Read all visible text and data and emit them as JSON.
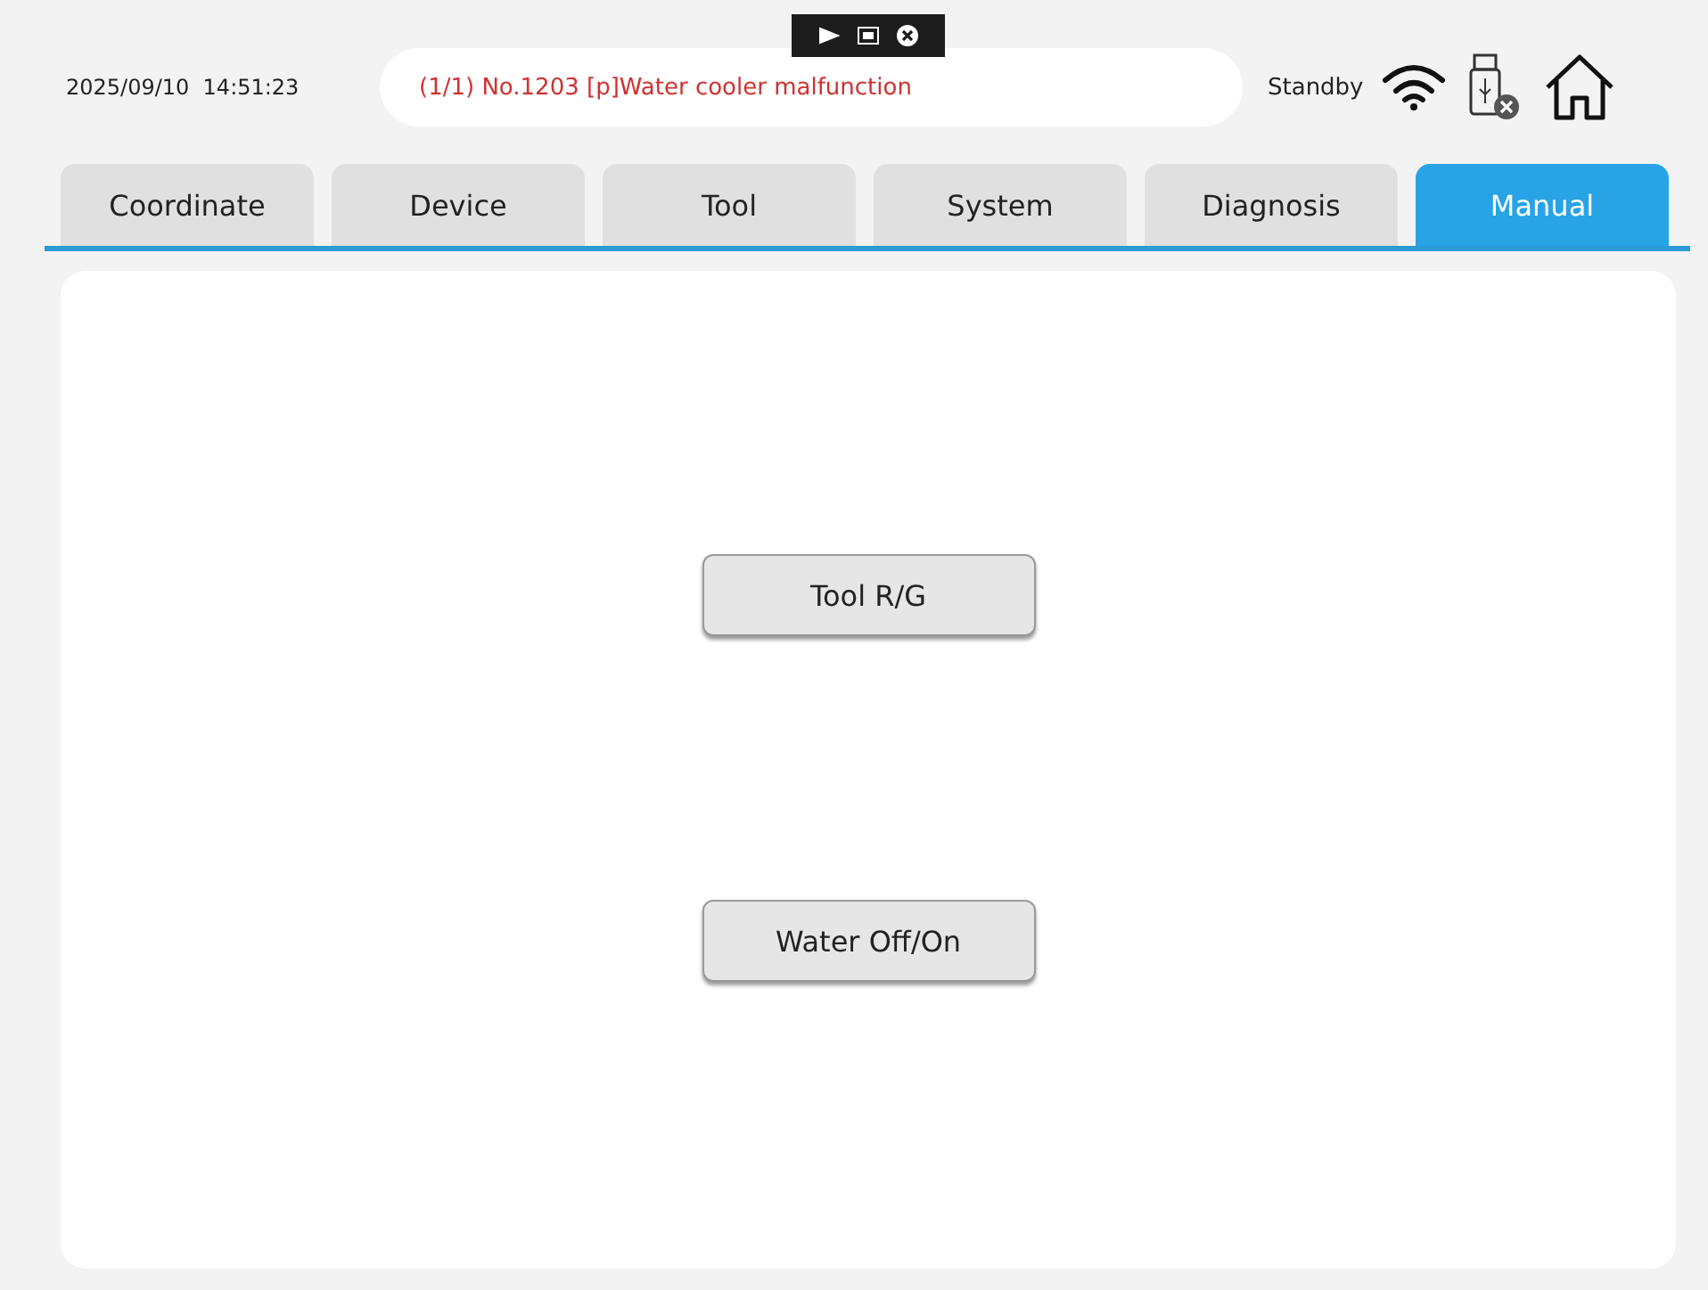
{
  "header": {
    "datetime": "2025/09/10  14:51:23",
    "alarm": "(1/1) No.1203 [p]Water cooler malfunction",
    "status": "Standby"
  },
  "tabs": [
    {
      "label": "Coordinate",
      "selected": false
    },
    {
      "label": "Device",
      "selected": false
    },
    {
      "label": "Tool",
      "selected": false
    },
    {
      "label": "System",
      "selected": false
    },
    {
      "label": "Diagnosis",
      "selected": false
    },
    {
      "label": "Manual",
      "selected": true
    }
  ],
  "buttons": [
    {
      "label": "Tool R/G"
    },
    {
      "label": "Water Off/On"
    }
  ]
}
